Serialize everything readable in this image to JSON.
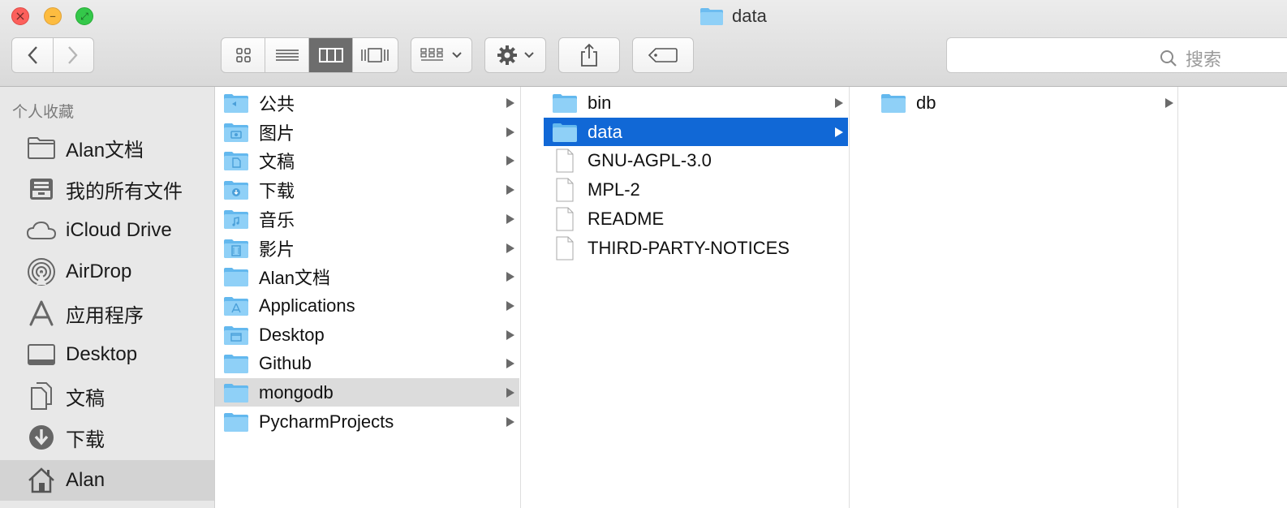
{
  "window": {
    "title": "data",
    "title_icon": "folder-icon"
  },
  "toolbar": {
    "back_icon": "chevron-left-icon",
    "forward_icon": "chevron-right-icon",
    "view_icons": [
      "icon-view-icon",
      "list-view-icon",
      "column-view-icon",
      "cover-flow-icon"
    ],
    "active_view": 2,
    "arrange_icon": "arrange-grid-icon",
    "action_icon": "gear-icon",
    "share_icon": "share-icon",
    "tags_icon": "tag-icon",
    "search_placeholder": "搜索"
  },
  "sidebar": {
    "header": "个人收藏",
    "items": [
      {
        "label": "Alan文档",
        "icon": "folder-icon"
      },
      {
        "label": "我的所有文件",
        "icon": "all-files-icon"
      },
      {
        "label": "iCloud Drive",
        "icon": "cloud-icon"
      },
      {
        "label": "AirDrop",
        "icon": "airdrop-icon"
      },
      {
        "label": "应用程序",
        "icon": "applications-icon"
      },
      {
        "label": "Desktop",
        "icon": "desktop-icon"
      },
      {
        "label": "文稿",
        "icon": "documents-icon"
      },
      {
        "label": "下载",
        "icon": "download-icon"
      },
      {
        "label": "Alan",
        "icon": "home-icon"
      }
    ],
    "selected": 8
  },
  "columns": [
    {
      "items": [
        {
          "name": "公共",
          "icon": "public-folder-icon",
          "arrow": true
        },
        {
          "name": "图片",
          "icon": "pictures-folder-icon",
          "arrow": true
        },
        {
          "name": "文稿",
          "icon": "documents-folder-icon",
          "arrow": true
        },
        {
          "name": "下载",
          "icon": "downloads-folder-icon",
          "arrow": true
        },
        {
          "name": "音乐",
          "icon": "music-folder-icon",
          "arrow": true
        },
        {
          "name": "影片",
          "icon": "movies-folder-icon",
          "arrow": true
        },
        {
          "name": "Alan文档",
          "icon": "folder-icon",
          "arrow": true
        },
        {
          "name": "Applications",
          "icon": "applications-folder-icon",
          "arrow": true
        },
        {
          "name": "Desktop",
          "icon": "desktop-folder-icon",
          "arrow": true
        },
        {
          "name": "Github",
          "icon": "folder-icon",
          "arrow": true
        },
        {
          "name": "mongodb",
          "icon": "folder-icon",
          "arrow": true
        },
        {
          "name": "PycharmProjects",
          "icon": "folder-icon",
          "arrow": true
        }
      ],
      "path_item": 10
    },
    {
      "items": [
        {
          "name": "bin",
          "icon": "folder-icon",
          "arrow": true
        },
        {
          "name": "data",
          "icon": "folder-icon",
          "arrow": true
        },
        {
          "name": "GNU-AGPL-3.0",
          "icon": "file-icon",
          "arrow": false
        },
        {
          "name": "MPL-2",
          "icon": "file-icon",
          "arrow": false
        },
        {
          "name": "README",
          "icon": "file-icon",
          "arrow": false
        },
        {
          "name": "THIRD-PARTY-NOTICES",
          "icon": "file-icon",
          "arrow": false
        }
      ],
      "selected_item": 1
    },
    {
      "items": [
        {
          "name": "db",
          "icon": "folder-icon",
          "arrow": true
        }
      ]
    }
  ],
  "colors": {
    "selection": "#1168d6",
    "folder": "#7ec8f5",
    "sidebar_bg": "#e8e8e8",
    "path_highlight": "#dcdcdc"
  }
}
